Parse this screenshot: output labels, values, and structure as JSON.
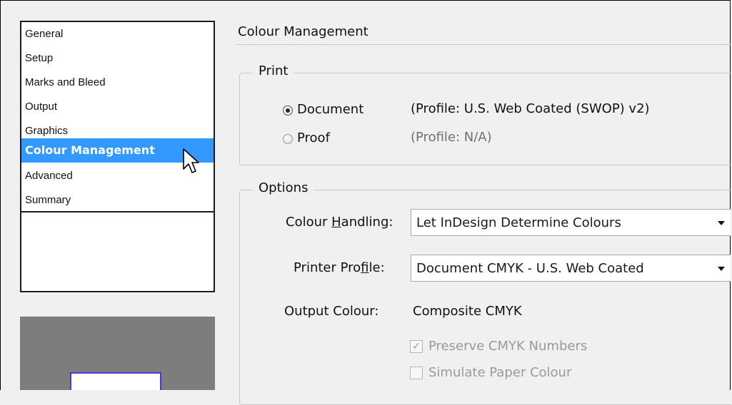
{
  "sidebar": {
    "items": [
      {
        "label": "General"
      },
      {
        "label": "Setup"
      },
      {
        "label": "Marks and Bleed"
      },
      {
        "label": "Output"
      },
      {
        "label": "Graphics"
      },
      {
        "label": "Colour Management",
        "selected": true
      },
      {
        "label": "Advanced"
      },
      {
        "label": "Summary"
      }
    ]
  },
  "main": {
    "section_title": "Colour Management",
    "print_group": {
      "label": "Print",
      "document_label": "Document",
      "document_profile": "(Profile: U.S. Web Coated (SWOP) v2)",
      "proof_label": "Proof",
      "proof_profile": "(Profile: N/A)",
      "selected": "Document"
    },
    "options_group": {
      "label": "Options",
      "colour_handling_label_pre": "Colour ",
      "colour_handling_label_u": "H",
      "colour_handling_label_post": "andling:",
      "colour_handling_value": "Let InDesign Determine Colours",
      "printer_profile_label_pre": "Printer Pro",
      "printer_profile_label_u": "f",
      "printer_profile_label_post": "ile:",
      "printer_profile_value": "Document CMYK - U.S. Web Coated",
      "output_colour_label": "Output Colour:",
      "output_colour_value": "Composite CMYK",
      "preserve_cmyk_label": "Preserve CMYK Numbers",
      "preserve_cmyk_checked": true,
      "simulate_paper_label": "Simulate Paper Colour",
      "simulate_paper_checked": false
    }
  },
  "colors": {
    "selection": "#3399ff",
    "preview_bg": "#7d7d7d",
    "preview_border": "#3d3ddc"
  }
}
